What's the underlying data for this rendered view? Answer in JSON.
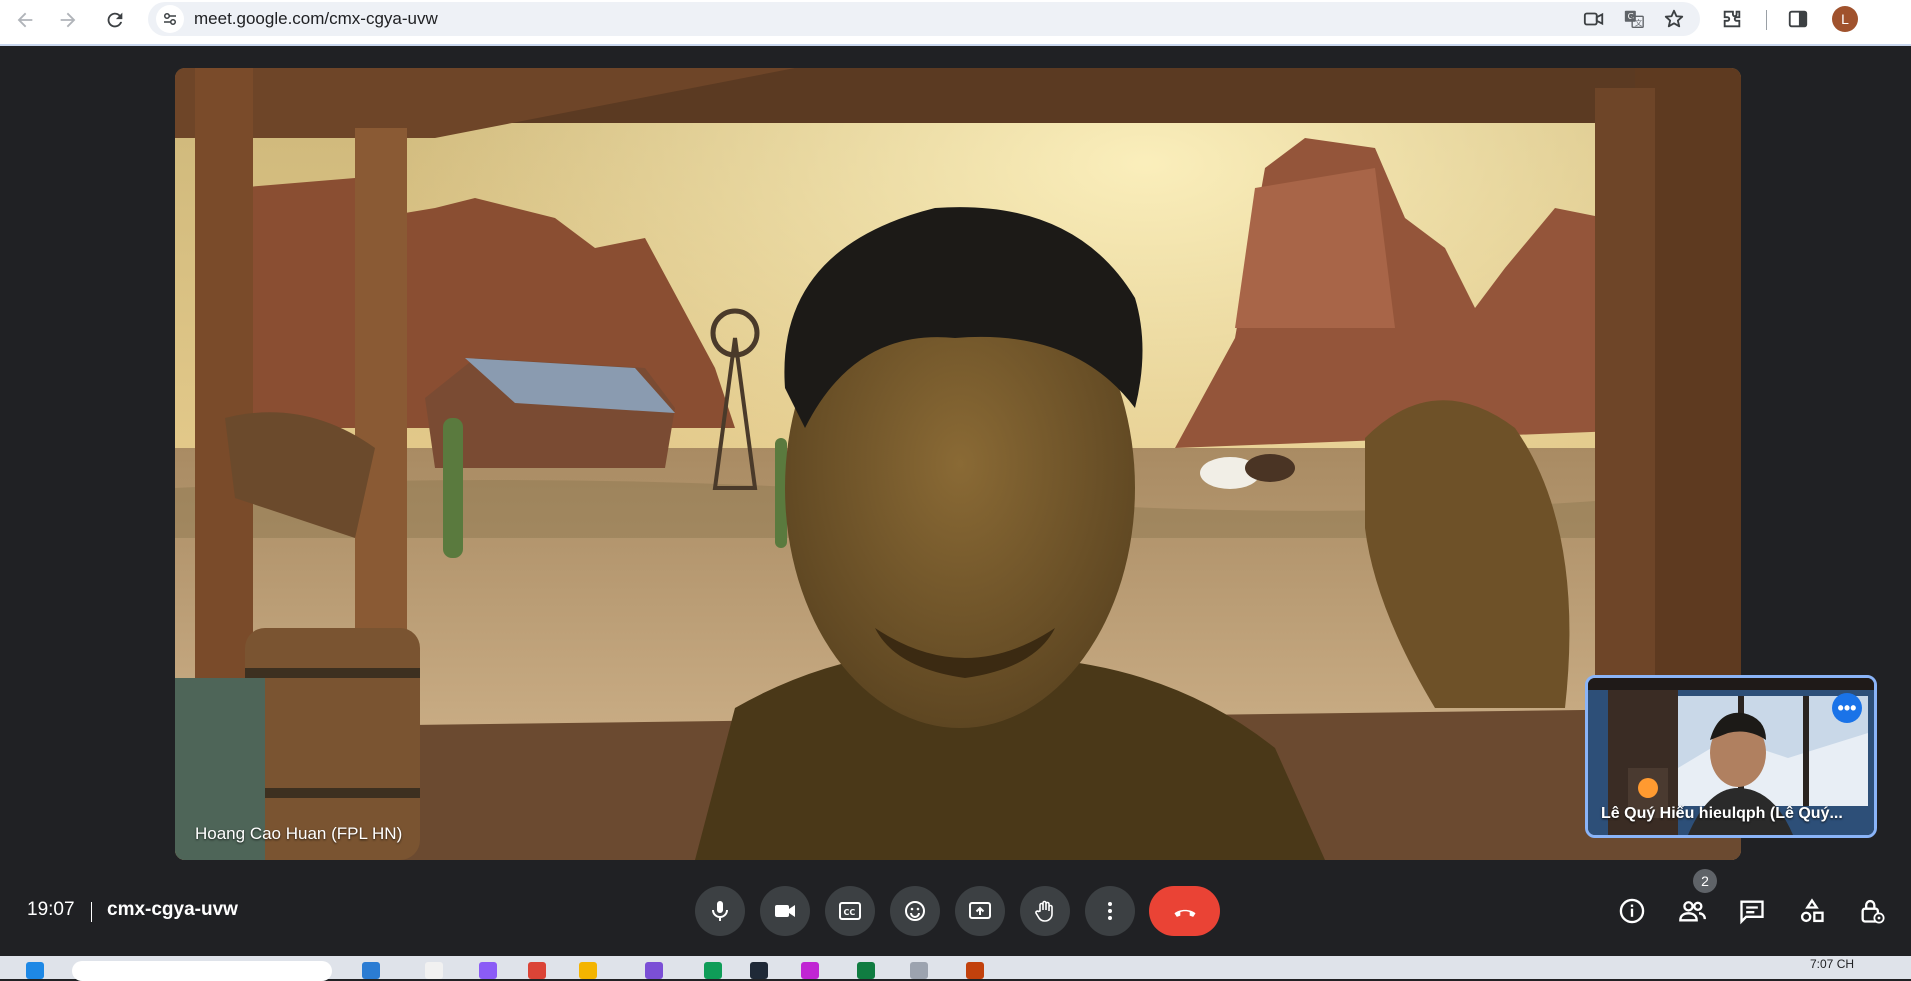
{
  "browser": {
    "url": "meet.google.com/cmx-cgya-uvw",
    "profile_initial": "L",
    "icons": [
      "back-icon",
      "forward-icon",
      "reload-icon",
      "site-info-icon",
      "video-camera-icon",
      "translate-icon",
      "star-icon",
      "extensions-icon",
      "side-panel-icon"
    ]
  },
  "meeting": {
    "main_participant": "Hoang Cao Huan (FPL HN)",
    "self_participant": "Lê Quý Hiếu hieulqph (Lê Quý...",
    "self_more_label": "•••"
  },
  "bottom_bar": {
    "time": "19:07",
    "meeting_code": "cmx-cgya-uvw",
    "participants_count": "2",
    "controls": [
      "mic-icon",
      "camera-icon",
      "captions-icon",
      "emoji-icon",
      "present-icon",
      "raise-hand-icon",
      "more-options-icon",
      "leave-call-icon"
    ],
    "right_icons": [
      "info-icon",
      "people-icon",
      "chat-icon",
      "activities-icon",
      "host-controls-icon"
    ]
  },
  "taskbar": {
    "clock": "7:07 CH"
  },
  "colors": {
    "background": "#202124",
    "control": "#3c4043",
    "leave": "#ea4335",
    "accent": "#8ab4f8",
    "more_button": "#1a73e8"
  }
}
